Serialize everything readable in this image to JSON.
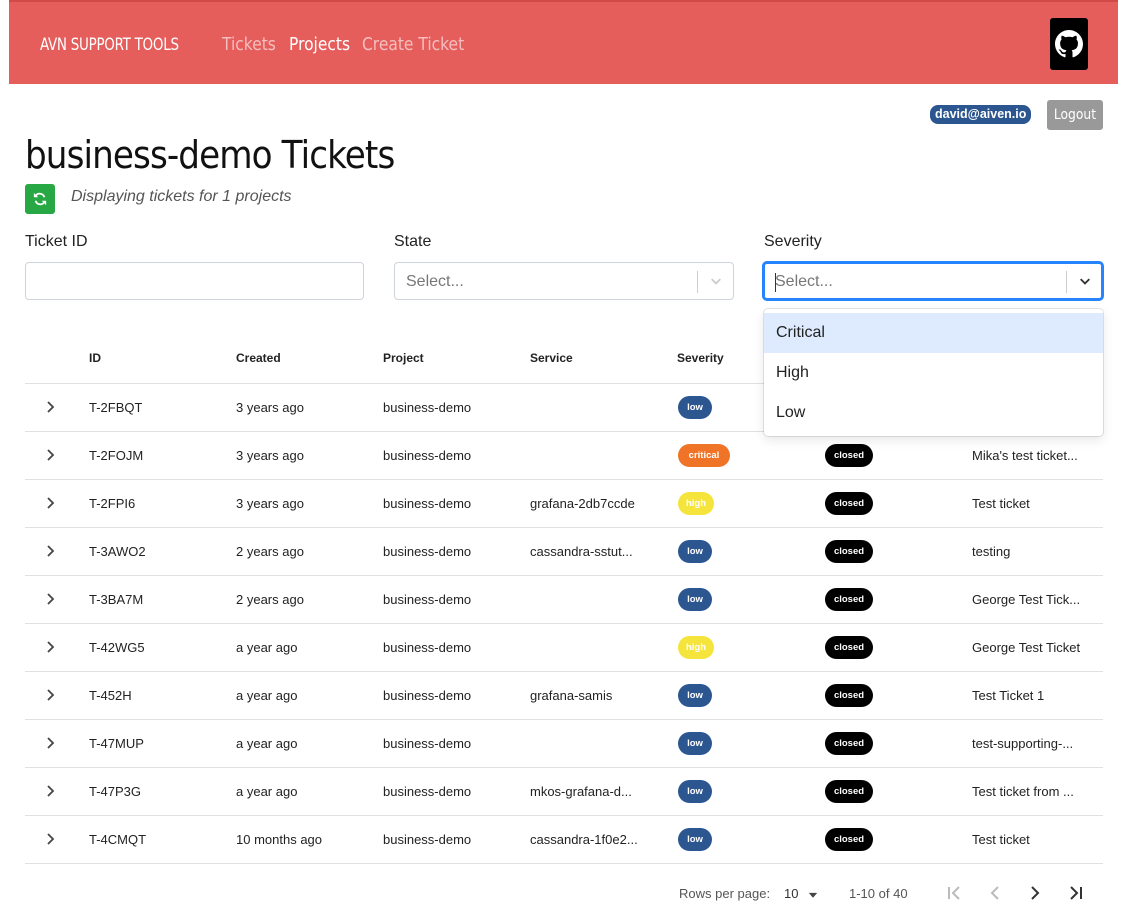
{
  "nav": {
    "brand": "AVN SUPPORT TOOLS",
    "links": [
      "Tickets",
      "Projects",
      "Create Ticket"
    ]
  },
  "user": {
    "email": "david@aiven.io",
    "logout_label": "Logout"
  },
  "page": {
    "title": "business-demo Tickets",
    "subtitle": "Displaying tickets for 1 projects"
  },
  "filters": {
    "ticket_id_label": "Ticket ID",
    "ticket_id_value": "",
    "state_label": "State",
    "state_placeholder": "Select...",
    "severity_label": "Severity",
    "severity_placeholder": "Select...",
    "severity_options": [
      "Critical",
      "High",
      "Low"
    ]
  },
  "table": {
    "headers": [
      "ID",
      "Created",
      "Project",
      "Service",
      "Severity"
    ],
    "rows": [
      {
        "id": "T-2FBQT",
        "created": "3 years ago",
        "project": "business-demo",
        "service": "",
        "severity": "low",
        "state": "",
        "description": ""
      },
      {
        "id": "T-2FOJM",
        "created": "3 years ago",
        "project": "business-demo",
        "service": "",
        "severity": "critical",
        "state": "closed",
        "description": "Mika's test ticket..."
      },
      {
        "id": "T-2FPI6",
        "created": "3 years ago",
        "project": "business-demo",
        "service": "grafana-2db7ccde",
        "severity": "high",
        "state": "closed",
        "description": "Test ticket"
      },
      {
        "id": "T-3AWO2",
        "created": "2 years ago",
        "project": "business-demo",
        "service": "cassandra-sstut...",
        "severity": "low",
        "state": "closed",
        "description": "testing"
      },
      {
        "id": "T-3BA7M",
        "created": "2 years ago",
        "project": "business-demo",
        "service": "",
        "severity": "low",
        "state": "closed",
        "description": "George Test Tick..."
      },
      {
        "id": "T-42WG5",
        "created": "a year ago",
        "project": "business-demo",
        "service": "",
        "severity": "high",
        "state": "closed",
        "description": "George Test Ticket"
      },
      {
        "id": "T-452H",
        "created": "a year ago",
        "project": "business-demo",
        "service": "grafana-samis",
        "severity": "low",
        "state": "closed",
        "description": "Test Ticket 1"
      },
      {
        "id": "T-47MUP",
        "created": "a year ago",
        "project": "business-demo",
        "service": "",
        "severity": "low",
        "state": "closed",
        "description": "test-supporting-..."
      },
      {
        "id": "T-47P3G",
        "created": "a year ago",
        "project": "business-demo",
        "service": "mkos-grafana-d...",
        "severity": "low",
        "state": "closed",
        "description": "Test ticket from ..."
      },
      {
        "id": "T-4CMQT",
        "created": "10 months ago",
        "project": "business-demo",
        "service": "cassandra-1f0e2...",
        "severity": "low",
        "state": "closed",
        "description": "Test ticket"
      }
    ]
  },
  "pagination": {
    "rows_per_page_label": "Rows per page:",
    "rows_per_page_value": "10",
    "range": "1-10 of 40"
  },
  "colors": {
    "navbar": "#e55e5c",
    "low": "#2c5690",
    "critical": "#f07427",
    "high": "#f5e43c",
    "closed": "#000000",
    "refresh": "#28a745",
    "focus": "#2684ff"
  },
  "icons": [
    "github-icon",
    "refresh-icon",
    "chevron-down-icon",
    "chevron-right-icon",
    "first-page-icon",
    "prev-page-icon",
    "next-page-icon",
    "last-page-icon"
  ]
}
